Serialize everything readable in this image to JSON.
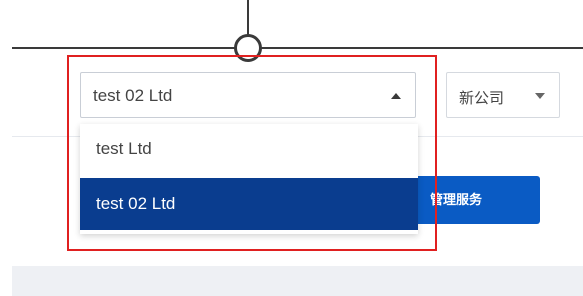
{
  "company_select": {
    "value": "test 02  Ltd",
    "options": [
      "test Ltd",
      "test 02 Ltd"
    ],
    "selected_index": 1
  },
  "language_select": {
    "value": "新公司"
  },
  "manage_button": {
    "label": "管理服务"
  },
  "colors": {
    "highlight_border": "#e02020",
    "selected_option_bg": "#0a3d8f",
    "button_bg": "#0a5bc4"
  }
}
